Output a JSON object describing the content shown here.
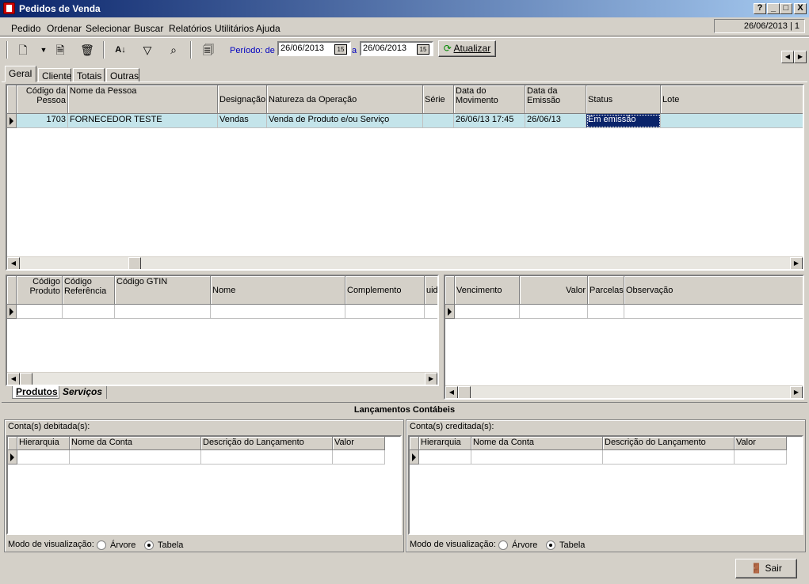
{
  "window": {
    "title": "Pedidos de Venda",
    "controls": [
      "?",
      "_",
      "□",
      "X"
    ]
  },
  "menu": {
    "items": [
      {
        "label": "Pedido",
        "key": "P"
      },
      {
        "label": "Ordenar",
        "key": "O"
      },
      {
        "label": "Selecionar",
        "key": "S"
      },
      {
        "label": "Buscar",
        "key": "B"
      },
      {
        "label": "Relatórios",
        "key": "R"
      },
      {
        "label": "Utilitários",
        "key": "U"
      },
      {
        "label": "Ajuda",
        "key": "A"
      }
    ],
    "status_box": "26/06/2013 | 1"
  },
  "toolbar": {
    "period_label": "Período: de",
    "date_from": "26/06/2013",
    "date_sep": "a",
    "date_to": "26/06/2013",
    "cal_label": "15",
    "refresh_label": "Atualizar"
  },
  "tabs": [
    "Geral",
    "Cliente",
    "Totais",
    "Outras"
  ],
  "orders_grid": {
    "columns": [
      "Código da Pessoa",
      "Nome da Pessoa",
      "Designação",
      "Natureza da Operação",
      "Série",
      "Data do Movimento",
      "Data da Emissão",
      "Status",
      "Lote"
    ],
    "rows": [
      {
        "codigo": "1703",
        "nome": "FORNECEDOR TESTE",
        "designacao": "Vendas",
        "natureza": "Venda de Produto e/ou Serviço",
        "serie": "",
        "data_mov": "26/06/13 17:45",
        "data_emissao": "26/06/13",
        "status": "Em emissão",
        "lote": ""
      }
    ]
  },
  "items_grid": {
    "columns": [
      "Código Produto",
      "Código Referência",
      "Código GTIN",
      "Nome",
      "Complemento",
      "uida"
    ],
    "tabs": [
      "Produtos",
      "Serviços"
    ]
  },
  "installments_grid": {
    "columns": [
      "Vencimento",
      "Valor",
      "Parcelas",
      "Observação"
    ]
  },
  "accounting": {
    "title": "Lançamentos Contábeis",
    "debit_label": "Conta(s) debitada(s):",
    "credit_label": "Conta(s) creditada(s):",
    "columns": [
      "Hierarquia",
      "Nome da Conta",
      "Descrição do Lançamento",
      "Valor"
    ],
    "view_mode_label": "Modo de visualização:",
    "option_tree": "Árvore",
    "option_table": "Tabela"
  },
  "footer": {
    "exit_label": "Sair"
  }
}
